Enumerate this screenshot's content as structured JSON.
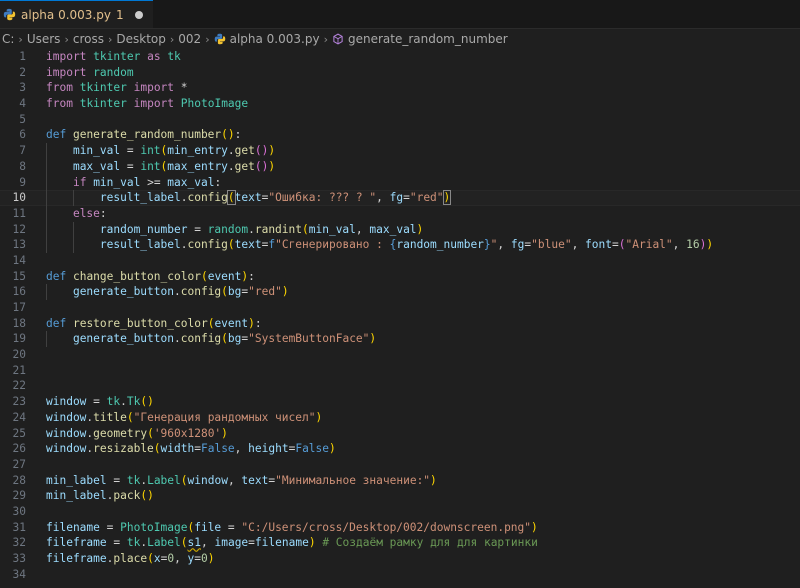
{
  "tab": {
    "title": "alpha 0.003.py",
    "badge": "1"
  },
  "breadcrumb": {
    "items": [
      "C:",
      "Users",
      "cross",
      "Desktop",
      "002"
    ],
    "file": "alpha 0.003.py",
    "symbol": "generate_random_number"
  },
  "editor": {
    "current_line": 10,
    "lines": [
      [
        [
          "kw",
          "import"
        ],
        [
          "op",
          " "
        ],
        [
          "cls",
          "tkinter"
        ],
        [
          "op",
          " "
        ],
        [
          "kw",
          "as"
        ],
        [
          "op",
          " "
        ],
        [
          "cls",
          "tk"
        ]
      ],
      [
        [
          "kw",
          "import"
        ],
        [
          "op",
          " "
        ],
        [
          "cls",
          "random"
        ]
      ],
      [
        [
          "kw",
          "from"
        ],
        [
          "op",
          " "
        ],
        [
          "cls",
          "tkinter"
        ],
        [
          "op",
          " "
        ],
        [
          "kw",
          "import"
        ],
        [
          "op",
          " *"
        ]
      ],
      [
        [
          "kw",
          "from"
        ],
        [
          "op",
          " "
        ],
        [
          "cls",
          "tkinter"
        ],
        [
          "op",
          " "
        ],
        [
          "kw",
          "import"
        ],
        [
          "op",
          " "
        ],
        [
          "cls",
          "PhotoImage"
        ]
      ],
      [],
      [
        [
          "kwb",
          "def"
        ],
        [
          "op",
          " "
        ],
        [
          "fn",
          "generate_random_number"
        ],
        [
          "br1",
          "()"
        ],
        [
          "op",
          ":"
        ]
      ],
      [
        [
          "op",
          "    "
        ],
        [
          "var",
          "min_val"
        ],
        [
          "op",
          " = "
        ],
        [
          "cls",
          "int"
        ],
        [
          "br1",
          "("
        ],
        [
          "var",
          "min_entry"
        ],
        [
          "op",
          "."
        ],
        [
          "fn",
          "get"
        ],
        [
          "br2",
          "()"
        ],
        [
          "br1",
          ")"
        ]
      ],
      [
        [
          "op",
          "    "
        ],
        [
          "var",
          "max_val"
        ],
        [
          "op",
          " = "
        ],
        [
          "cls",
          "int"
        ],
        [
          "br1",
          "("
        ],
        [
          "var",
          "max_entry"
        ],
        [
          "op",
          "."
        ],
        [
          "fn",
          "get"
        ],
        [
          "br2",
          "()"
        ],
        [
          "br1",
          ")"
        ]
      ],
      [
        [
          "op",
          "    "
        ],
        [
          "kw",
          "if"
        ],
        [
          "op",
          " "
        ],
        [
          "var",
          "min_val"
        ],
        [
          "op",
          " >= "
        ],
        [
          "var",
          "max_val"
        ],
        [
          "op",
          ":"
        ]
      ],
      [
        [
          "op",
          "        "
        ],
        [
          "var",
          "result_label"
        ],
        [
          "op",
          "."
        ],
        [
          "fn",
          "config"
        ],
        [
          "br1",
          "("
        ],
        [
          "var",
          "text"
        ],
        [
          "op",
          "="
        ],
        [
          "str",
          "\"Ошибка: ??? ? \""
        ],
        [
          "op",
          ", "
        ],
        [
          "var",
          "fg"
        ],
        [
          "op",
          "="
        ],
        [
          "str",
          "\"red\""
        ],
        [
          "br1",
          ")"
        ]
      ],
      [
        [
          "op",
          "    "
        ],
        [
          "kw",
          "else"
        ],
        [
          "op",
          ":"
        ]
      ],
      [
        [
          "op",
          "        "
        ],
        [
          "var",
          "random_number"
        ],
        [
          "op",
          " = "
        ],
        [
          "cls",
          "random"
        ],
        [
          "op",
          "."
        ],
        [
          "fn",
          "randint"
        ],
        [
          "br1",
          "("
        ],
        [
          "var",
          "min_val"
        ],
        [
          "op",
          ", "
        ],
        [
          "var",
          "max_val"
        ],
        [
          "br1",
          ")"
        ]
      ],
      [
        [
          "op",
          "        "
        ],
        [
          "var",
          "result_label"
        ],
        [
          "op",
          "."
        ],
        [
          "fn",
          "config"
        ],
        [
          "br1",
          "("
        ],
        [
          "var",
          "text"
        ],
        [
          "op",
          "="
        ],
        [
          "kwb",
          "f"
        ],
        [
          "str",
          "\"Сгенерировано : "
        ],
        [
          "kwb",
          "{"
        ],
        [
          "var",
          "random_number"
        ],
        [
          "kwb",
          "}"
        ],
        [
          "str",
          "\""
        ],
        [
          "op",
          ", "
        ],
        [
          "var",
          "fg"
        ],
        [
          "op",
          "="
        ],
        [
          "str",
          "\"blue\""
        ],
        [
          "op",
          ", "
        ],
        [
          "var",
          "font"
        ],
        [
          "op",
          "="
        ],
        [
          "br2",
          "("
        ],
        [
          "str",
          "\"Arial\""
        ],
        [
          "op",
          ", "
        ],
        [
          "num",
          "16"
        ],
        [
          "br2",
          ")"
        ],
        [
          "br1",
          ")"
        ]
      ],
      [],
      [
        [
          "kwb",
          "def"
        ],
        [
          "op",
          " "
        ],
        [
          "fn",
          "change_button_color"
        ],
        [
          "br1",
          "("
        ],
        [
          "var",
          "event"
        ],
        [
          "br1",
          ")"
        ],
        [
          "op",
          ":"
        ]
      ],
      [
        [
          "op",
          "    "
        ],
        [
          "var",
          "generate_button"
        ],
        [
          "op",
          "."
        ],
        [
          "fn",
          "config"
        ],
        [
          "br1",
          "("
        ],
        [
          "var",
          "bg"
        ],
        [
          "op",
          "="
        ],
        [
          "str",
          "\"red\""
        ],
        [
          "br1",
          ")"
        ]
      ],
      [],
      [
        [
          "kwb",
          "def"
        ],
        [
          "op",
          " "
        ],
        [
          "fn",
          "restore_button_color"
        ],
        [
          "br1",
          "("
        ],
        [
          "var",
          "event"
        ],
        [
          "br1",
          ")"
        ],
        [
          "op",
          ":"
        ]
      ],
      [
        [
          "op",
          "    "
        ],
        [
          "var",
          "generate_button"
        ],
        [
          "op",
          "."
        ],
        [
          "fn",
          "config"
        ],
        [
          "br1",
          "("
        ],
        [
          "var",
          "bg"
        ],
        [
          "op",
          "="
        ],
        [
          "str",
          "\"SystemButtonFace\""
        ],
        [
          "br1",
          ")"
        ]
      ],
      [],
      [],
      [],
      [
        [
          "var",
          "window"
        ],
        [
          "op",
          " = "
        ],
        [
          "cls",
          "tk"
        ],
        [
          "op",
          "."
        ],
        [
          "cls",
          "Tk"
        ],
        [
          "br1",
          "()"
        ]
      ],
      [
        [
          "var",
          "window"
        ],
        [
          "op",
          "."
        ],
        [
          "fn",
          "title"
        ],
        [
          "br1",
          "("
        ],
        [
          "str",
          "\"Генерация рандомных чисел\""
        ],
        [
          "br1",
          ")"
        ]
      ],
      [
        [
          "var",
          "window"
        ],
        [
          "op",
          "."
        ],
        [
          "fn",
          "geometry"
        ],
        [
          "br1",
          "("
        ],
        [
          "str",
          "'960x1280'"
        ],
        [
          "br1",
          ")"
        ]
      ],
      [
        [
          "var",
          "window"
        ],
        [
          "op",
          "."
        ],
        [
          "fn",
          "resizable"
        ],
        [
          "br1",
          "("
        ],
        [
          "var",
          "width"
        ],
        [
          "op",
          "="
        ],
        [
          "kwb",
          "False"
        ],
        [
          "op",
          ", "
        ],
        [
          "var",
          "height"
        ],
        [
          "op",
          "="
        ],
        [
          "kwb",
          "False"
        ],
        [
          "br1",
          ")"
        ]
      ],
      [],
      [
        [
          "var",
          "min_label"
        ],
        [
          "op",
          " = "
        ],
        [
          "cls",
          "tk"
        ],
        [
          "op",
          "."
        ],
        [
          "cls",
          "Label"
        ],
        [
          "br1",
          "("
        ],
        [
          "var",
          "window"
        ],
        [
          "op",
          ", "
        ],
        [
          "var",
          "text"
        ],
        [
          "op",
          "="
        ],
        [
          "str",
          "\"Минимальное значение:\""
        ],
        [
          "br1",
          ")"
        ]
      ],
      [
        [
          "var",
          "min_label"
        ],
        [
          "op",
          "."
        ],
        [
          "fn",
          "pack"
        ],
        [
          "br1",
          "()"
        ]
      ],
      [],
      [
        [
          "var",
          "filename"
        ],
        [
          "op",
          " = "
        ],
        [
          "cls",
          "PhotoImage"
        ],
        [
          "br1",
          "("
        ],
        [
          "var",
          "file"
        ],
        [
          "op",
          " = "
        ],
        [
          "str",
          "\"C:/Users/cross/Desktop/002/downscreen.png\""
        ],
        [
          "br1",
          ")"
        ]
      ],
      [
        [
          "var",
          "fileframe"
        ],
        [
          "op",
          " = "
        ],
        [
          "cls",
          "tk"
        ],
        [
          "op",
          "."
        ],
        [
          "cls",
          "Label"
        ],
        [
          "br1",
          "("
        ],
        [
          "var",
          "s1"
        ],
        [
          "op",
          ", "
        ],
        [
          "var",
          "image"
        ],
        [
          "op",
          "="
        ],
        [
          "var",
          "filename"
        ],
        [
          "br1",
          ")"
        ],
        [
          "op",
          " "
        ],
        [
          "cm",
          "# Создаём рамку для для картинки"
        ]
      ],
      [
        [
          "var",
          "fileframe"
        ],
        [
          "op",
          "."
        ],
        [
          "fn",
          "place"
        ],
        [
          "br1",
          "("
        ],
        [
          "var",
          "x"
        ],
        [
          "op",
          "="
        ],
        [
          "num",
          "0"
        ],
        [
          "op",
          ", "
        ],
        [
          "var",
          "y"
        ],
        [
          "op",
          "="
        ],
        [
          "num",
          "0"
        ],
        [
          "br1",
          ")"
        ]
      ],
      []
    ]
  },
  "colors": {
    "background": "#1f1f1f",
    "tab_accent": "#0078d4",
    "modified_tab_text": "#e2c08d"
  },
  "icons": [
    "python-icon",
    "modified-dot-icon",
    "chevron-right-icon",
    "symbol-method-icon"
  ]
}
